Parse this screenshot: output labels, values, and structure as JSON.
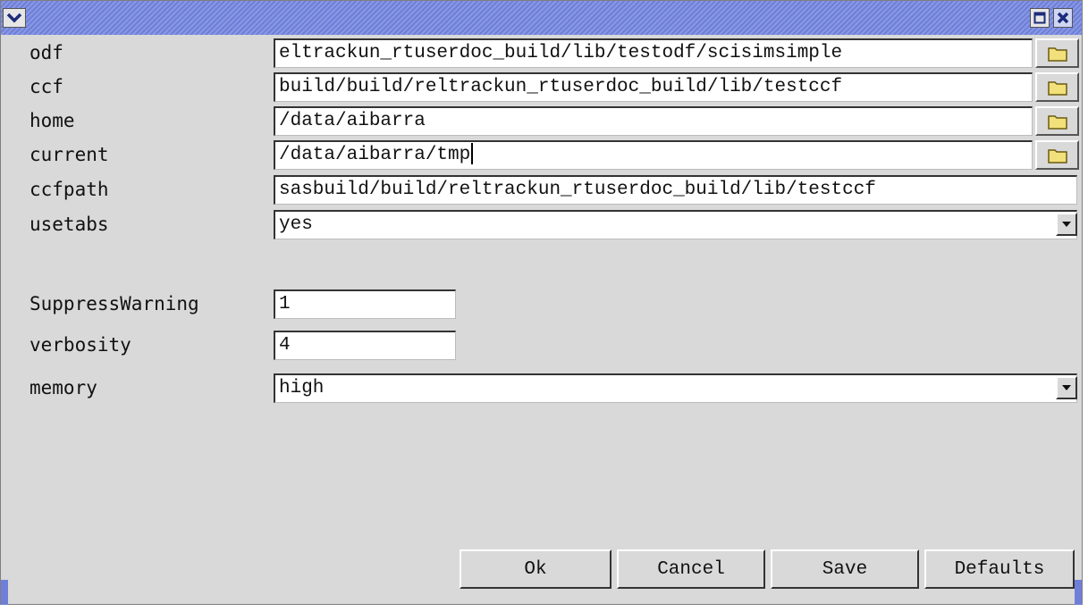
{
  "fields": [
    {
      "label": "odf",
      "value": "eltrackun_rtuserdoc_build/lib/testodf/scisimsimple"
    },
    {
      "label": "ccf",
      "value": "build/build/reltrackun_rtuserdoc_build/lib/testccf"
    },
    {
      "label": "home",
      "value": "/data/aibarra"
    },
    {
      "label": "current",
      "value": "/data/aibarra/tmp"
    },
    {
      "label": "ccfpath",
      "value": "sasbuild/build/reltrackun_rtuserdoc_build/lib/testccf"
    },
    {
      "label": "usetabs",
      "value": "yes"
    },
    {
      "label": "SuppressWarning",
      "value": "1"
    },
    {
      "label": "verbosity",
      "value": "4"
    },
    {
      "label": "memory",
      "value": "high"
    }
  ],
  "buttons": {
    "ok": "Ok",
    "cancel": "Cancel",
    "save": "Save",
    "defaults": "Defaults"
  },
  "titlebar": {
    "menu_icon": "chevron-down-icon",
    "maximize_icon": "maximize-icon",
    "close_icon": "close-icon"
  },
  "colors": {
    "titlebar": "#7f8fe0",
    "panel": "#d9d9d9",
    "folder": "#f2e07a"
  }
}
